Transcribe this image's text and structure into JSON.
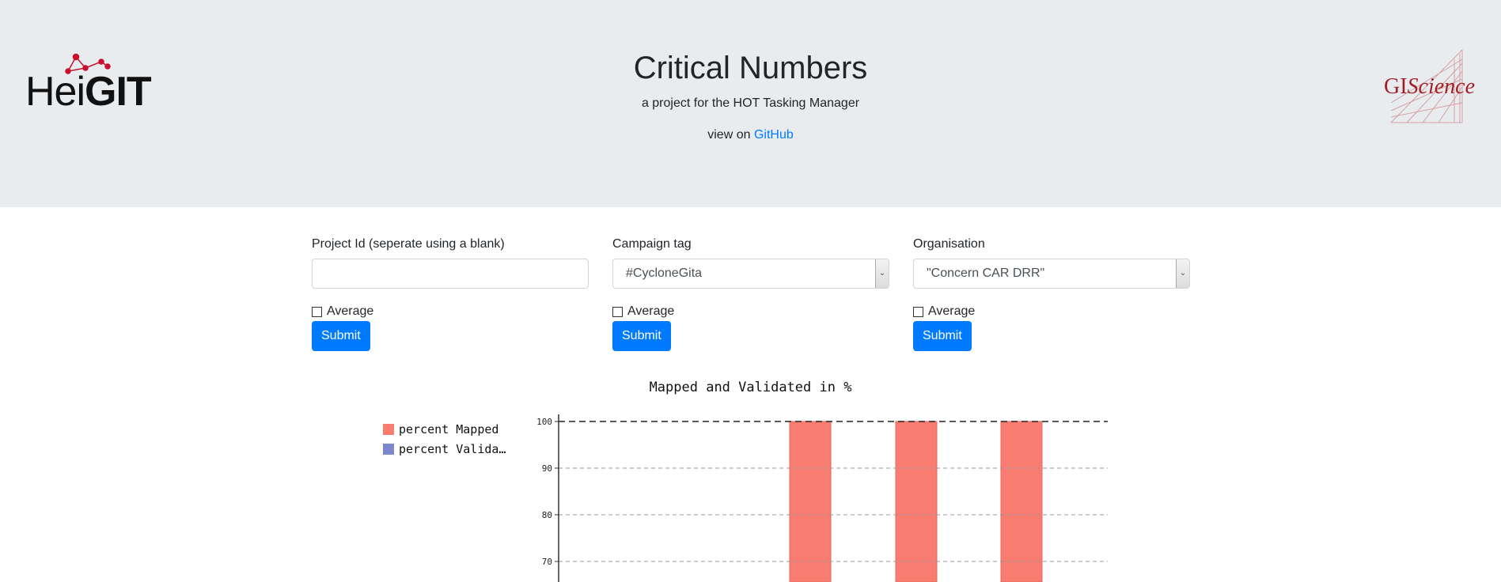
{
  "header": {
    "title": "Critical Numbers",
    "subtitle": "a project for the HOT Tasking Manager",
    "github_prefix": "view on",
    "github_link": "GitHub",
    "logo_left_a": "Hei",
    "logo_left_b": "GIT",
    "logo_right_a": "GI",
    "logo_right_b": "Science"
  },
  "forms": {
    "project": {
      "label": "Project Id (seperate using a blank)",
      "value": "",
      "average_label": "Average",
      "average_checked": false,
      "submit_label": "Submit"
    },
    "campaign": {
      "label": "Campaign tag",
      "selected": "#CycloneGita",
      "average_label": "Average",
      "average_checked": false,
      "submit_label": "Submit"
    },
    "organisation": {
      "label": "Organisation",
      "selected": "\"Concern CAR DRR\"",
      "average_label": "Average",
      "average_checked": false,
      "submit_label": "Submit"
    }
  },
  "colors": {
    "accent": "#007bff",
    "mapped": "#f97c71",
    "validated": "#7b86cc",
    "header_bg": "#e9ecef"
  },
  "chart_data": {
    "type": "bar",
    "title": "Mapped and Validated in %",
    "legend": [
      "percent Mapped",
      "percent Valida…"
    ],
    "legend_position": "top-left",
    "grid": true,
    "y_ticks": [
      100,
      90,
      80,
      70
    ],
    "ylim": [
      70,
      100
    ],
    "series": [
      {
        "name": "percent Mapped",
        "values": [
          100,
          100,
          100
        ]
      },
      {
        "name": "percent Valida…",
        "values": []
      }
    ]
  }
}
